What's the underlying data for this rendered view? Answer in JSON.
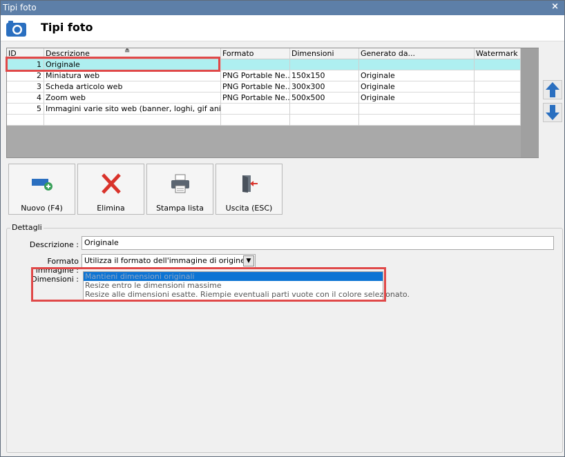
{
  "window": {
    "title": "Tipi foto",
    "close_glyph": "×"
  },
  "header": {
    "title": "Tipi foto",
    "icon": "camera-icon"
  },
  "grid": {
    "columns": [
      "ID",
      "Descrizione",
      "Formato",
      "Dimensioni",
      "Generato da...",
      "Watermark"
    ],
    "sort_glyph": "≜",
    "rows": [
      {
        "id": "1",
        "descrizione": "Originale",
        "formato": "",
        "dimensioni": "",
        "generato": "",
        "watermark": ""
      },
      {
        "id": "2",
        "descrizione": "Miniatura web",
        "formato": "PNG Portable Ne...",
        "dimensioni": "150x150",
        "generato": "Originale",
        "watermark": ""
      },
      {
        "id": "3",
        "descrizione": "Scheda articolo web",
        "formato": "PNG Portable Ne...",
        "dimensioni": "300x300",
        "generato": "Originale",
        "watermark": ""
      },
      {
        "id": "4",
        "descrizione": "Zoom web",
        "formato": "PNG Portable Ne...",
        "dimensioni": "500x500",
        "generato": "Originale",
        "watermark": ""
      },
      {
        "id": "5",
        "descrizione": "Immagini varie sito web (banner, loghi, gif animat...",
        "formato": "",
        "dimensioni": "",
        "generato": "",
        "watermark": ""
      }
    ],
    "selected_row": 0
  },
  "toolbar": {
    "nuovo": "Nuovo (F4)",
    "elimina": "Elimina",
    "stampa": "Stampa lista",
    "uscita": "Uscita (ESC)"
  },
  "details": {
    "legend": "Dettagli",
    "descrizione_label": "Descrizione :",
    "descrizione_value": "Originale",
    "formato_label": "Formato immagine :",
    "formato_value": "Utilizza il formato dell'immagine di origine",
    "dimensioni_label": "Dimensioni :",
    "dimensioni_options": [
      "Mantieni dimensioni originali",
      "Resize entro le dimensioni massime",
      "Resize alle dimensioni esatte. Riempie eventuali parti vuote con il colore selezionato."
    ],
    "dimensioni_selected": 0
  },
  "colors": {
    "titlebar": "#5d7fa8",
    "selection_row": "#aeeff0",
    "highlight": "#e04848",
    "accent_blue": "#2a6fc0",
    "delete_red": "#d9332b"
  }
}
